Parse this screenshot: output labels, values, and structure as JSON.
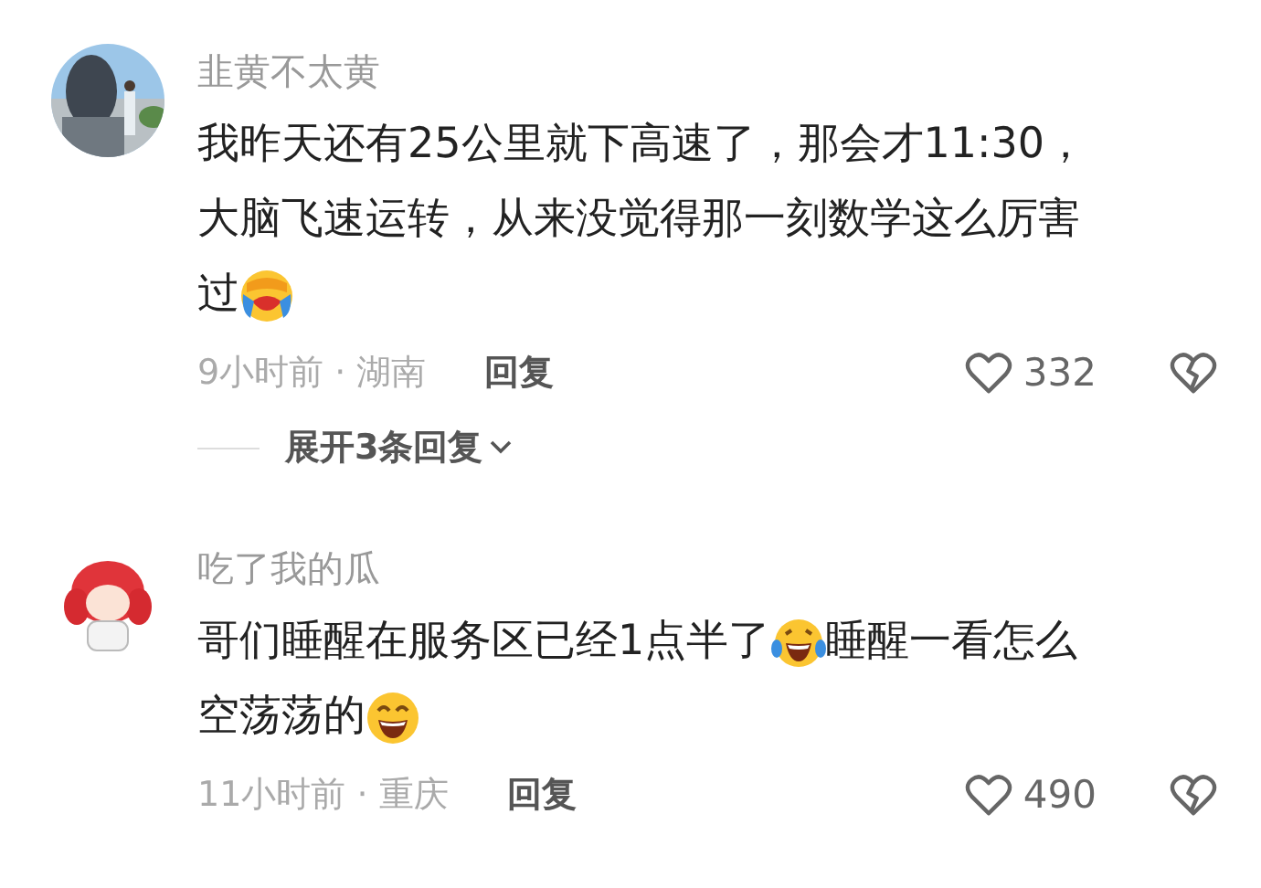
{
  "comments": [
    {
      "avatar": {
        "kind": "picture"
      },
      "username": "韭黄不太黄",
      "lines": [
        [
          {
            "kind": "text",
            "text": "我昨天还有25公里就下高速了，那会才11:30，"
          }
        ],
        [
          {
            "kind": "text",
            "text": "大脑飞速运转，从来没觉得那一刻数学这么厉害"
          }
        ],
        [
          {
            "kind": "text",
            "text": "过"
          },
          {
            "kind": "sob"
          }
        ]
      ],
      "meta": "9小时前 · 湖南",
      "reply": "回复",
      "likes": "332",
      "expand": "展开3条回复"
    },
    {
      "avatar": {
        "kind": "picture"
      },
      "username": "吃了我的瓜",
      "lines": [
        [
          {
            "kind": "text",
            "text": "哥们睡醒在服务区已经1点半了"
          },
          {
            "kind": "tears"
          },
          {
            "kind": "text",
            "text": "睡醒一看怎么"
          }
        ],
        [
          {
            "kind": "text",
            "text": "空荡荡的"
          },
          {
            "kind": "grin"
          }
        ]
      ],
      "meta": "11小时前 · 重庆",
      "reply": "回复",
      "likes": "490"
    }
  ]
}
